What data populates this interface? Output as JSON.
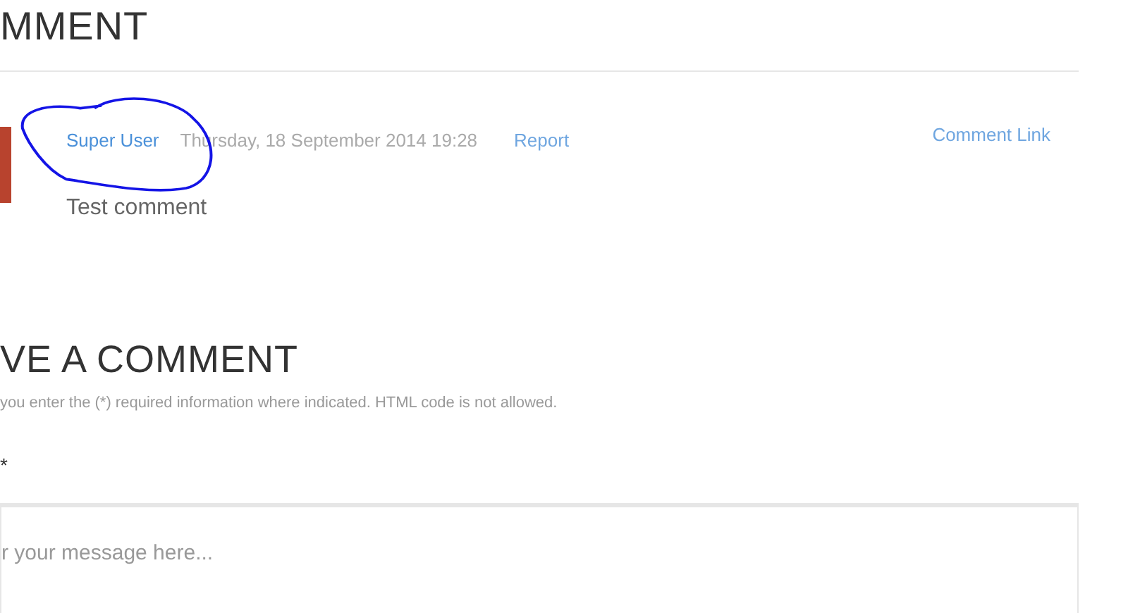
{
  "comments_heading": "MMENT",
  "comment": {
    "author": "Super User",
    "date": "Thursday, 18 September 2014 19:28",
    "report": "Report",
    "link": "Comment Link",
    "text": "Test comment"
  },
  "form": {
    "heading": "VE A COMMENT",
    "hint": "you enter the (*) required information where indicated. HTML code is not allowed.",
    "required_mark": "*",
    "message": {
      "placeholder": "r your message here..."
    }
  }
}
